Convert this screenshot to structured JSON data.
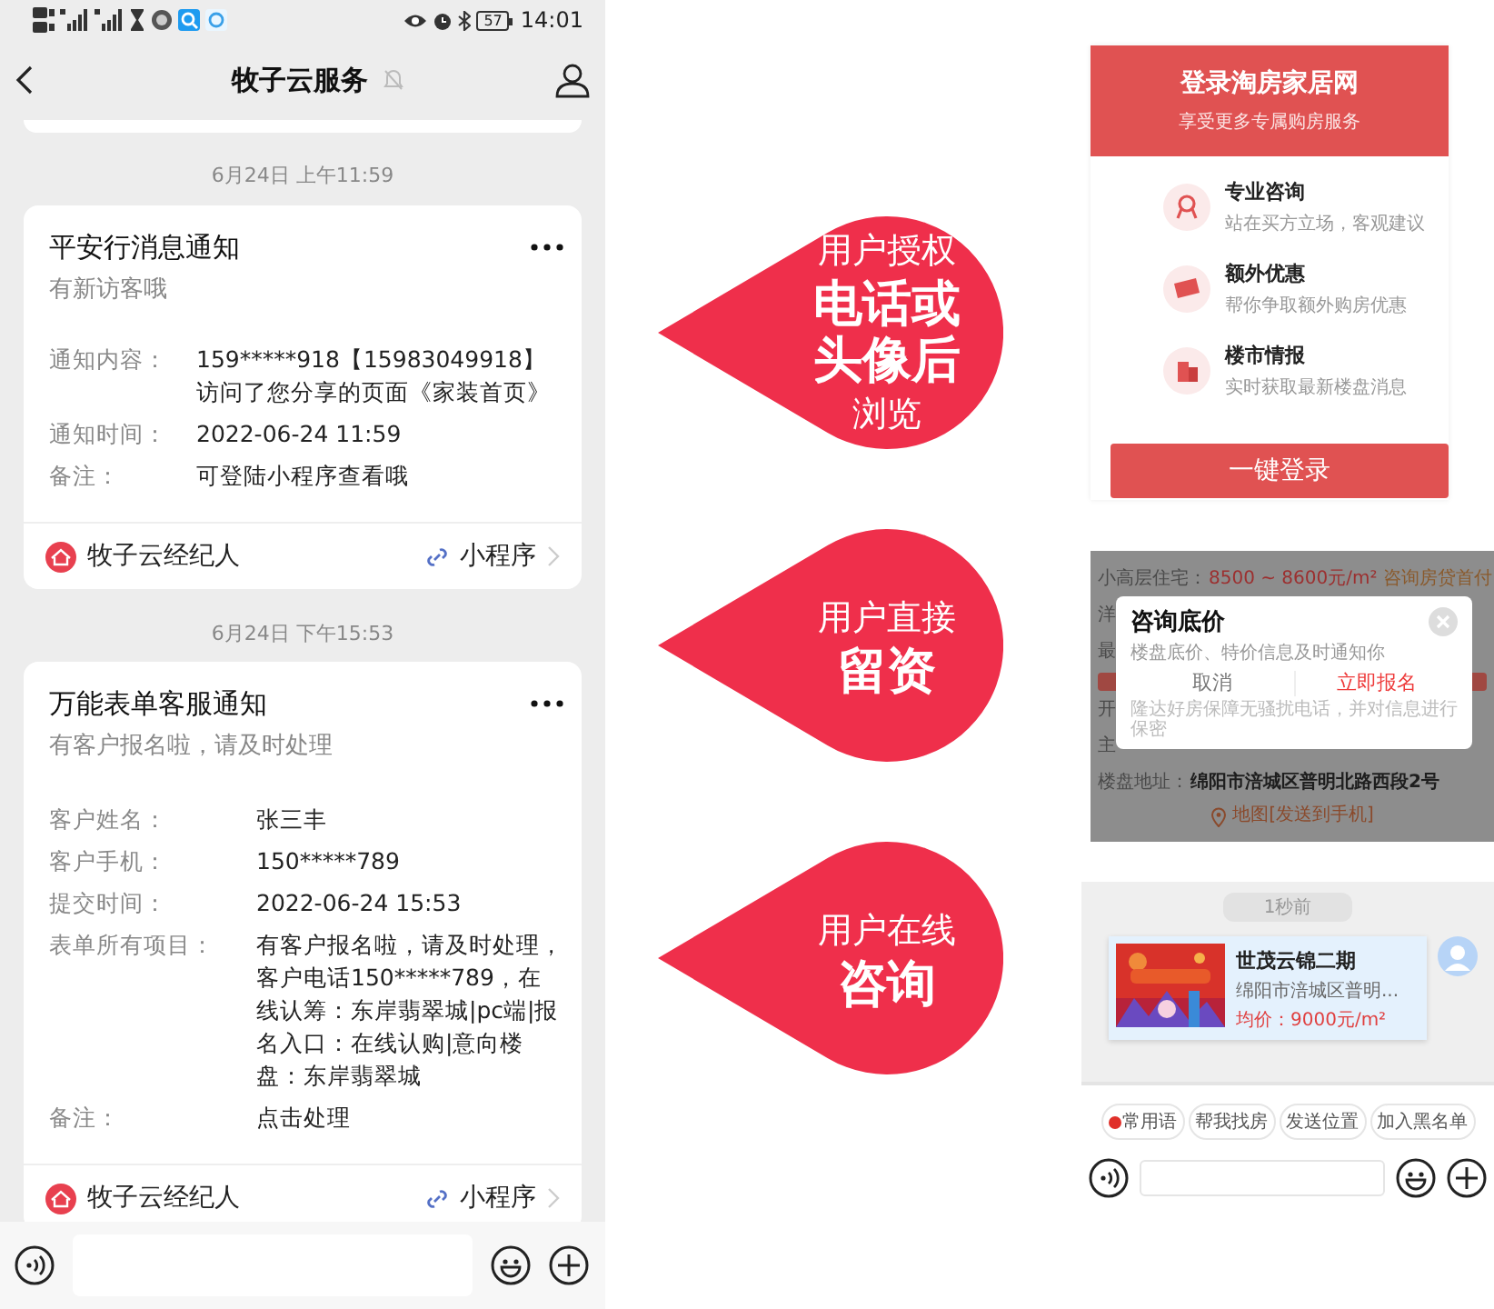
{
  "status_bar": {
    "battery": "57",
    "time": "14:01"
  },
  "header": {
    "title": "牧子云服务",
    "muted": true
  },
  "messages": [
    {
      "timestamp": "6月24日 上午11:59",
      "title": "平安行消息通知",
      "subtitle": "有新访客哦",
      "fields": [
        {
          "label": "通知内容：",
          "value": "159*****918【15983049918】访问了您分享的页面《家装首页》"
        },
        {
          "label": "通知时间：",
          "value": "2022-06-24 11:59"
        },
        {
          "label": "备注：",
          "value": "可登陆小程序查看哦"
        }
      ],
      "source": "牧子云经纪人",
      "link": "小程序"
    },
    {
      "timestamp": "6月24日 下午15:53",
      "title": "万能表单客服通知",
      "subtitle": "有客户报名啦，请及时处理",
      "fields": [
        {
          "label": "客户姓名：",
          "value": "张三丰"
        },
        {
          "label": "客户手机：",
          "value": "150*****789"
        },
        {
          "label": "提交时间：",
          "value": "2022-06-24 15:53"
        },
        {
          "label": "表单所有项目：",
          "value": "有客户报名啦，请及时处理，客户电话150*****789，在线认筹：东岸翡翠城|pc端|报名入口：在线认购|意向楼盘：东岸翡翠城"
        },
        {
          "label": "备注：",
          "value": "点击处理"
        }
      ],
      "source": "牧子云经纪人",
      "link": "小程序"
    }
  ],
  "callouts": [
    {
      "lines": [
        {
          "text": "用户授权",
          "emphasis": false
        },
        {
          "text": "电话或",
          "emphasis": true
        },
        {
          "text": "头像后",
          "emphasis": true
        },
        {
          "text": "浏览",
          "emphasis": false
        }
      ]
    },
    {
      "lines": [
        {
          "text": "用户直接",
          "emphasis": false
        },
        {
          "text": "留资",
          "emphasis": true
        }
      ]
    },
    {
      "lines": [
        {
          "text": "用户在线",
          "emphasis": false
        },
        {
          "text": "咨询",
          "emphasis": true
        }
      ]
    }
  ],
  "login_panel": {
    "title": "登录淘房家居网",
    "subtitle": "享受更多专属购房服务",
    "items": [
      {
        "kind": "medal",
        "title": "专业咨询",
        "description": "站在买方立场，客观建议"
      },
      {
        "kind": "ticket",
        "title": "额外优惠",
        "description": "帮你争取额外购房优惠"
      },
      {
        "kind": "building",
        "title": "楼市情报",
        "description": "实时获取最新楼盘消息"
      }
    ],
    "button": "一键登录"
  },
  "price_panel": {
    "price_row": {
      "label": "小高层住宅：",
      "value": "8500 ~ 8600元/m²",
      "link": "咨询房贷首付"
    },
    "partial_labels": [
      "洋",
      "最",
      "开",
      "主"
    ],
    "address": {
      "label": "楼盘地址：",
      "value": "绵阳市涪城区普明北路西段2号"
    },
    "map_link": "地图[发送到手机]",
    "dialog": {
      "title": "咨询底价",
      "description": "楼盘底价、特价信息及时通知你",
      "buttons": [
        {
          "label": "取消",
          "primary": false
        },
        {
          "label": "立即报名",
          "primary": true
        }
      ],
      "note": "隆达好房保障无骚扰电话，并对信息进行保密"
    }
  },
  "chat_panel": {
    "time": "1秒前",
    "card": {
      "title": "世茂云锦二期",
      "address": "绵阳市涪城区普明...",
      "price": "均价：9000元/m²"
    },
    "chips": [
      {
        "label": "常用语",
        "hot": true
      },
      {
        "label": "帮我找房",
        "hot": false
      },
      {
        "label": "发送位置",
        "hot": false
      },
      {
        "label": "加入黑名单",
        "hot": false
      }
    ]
  }
}
